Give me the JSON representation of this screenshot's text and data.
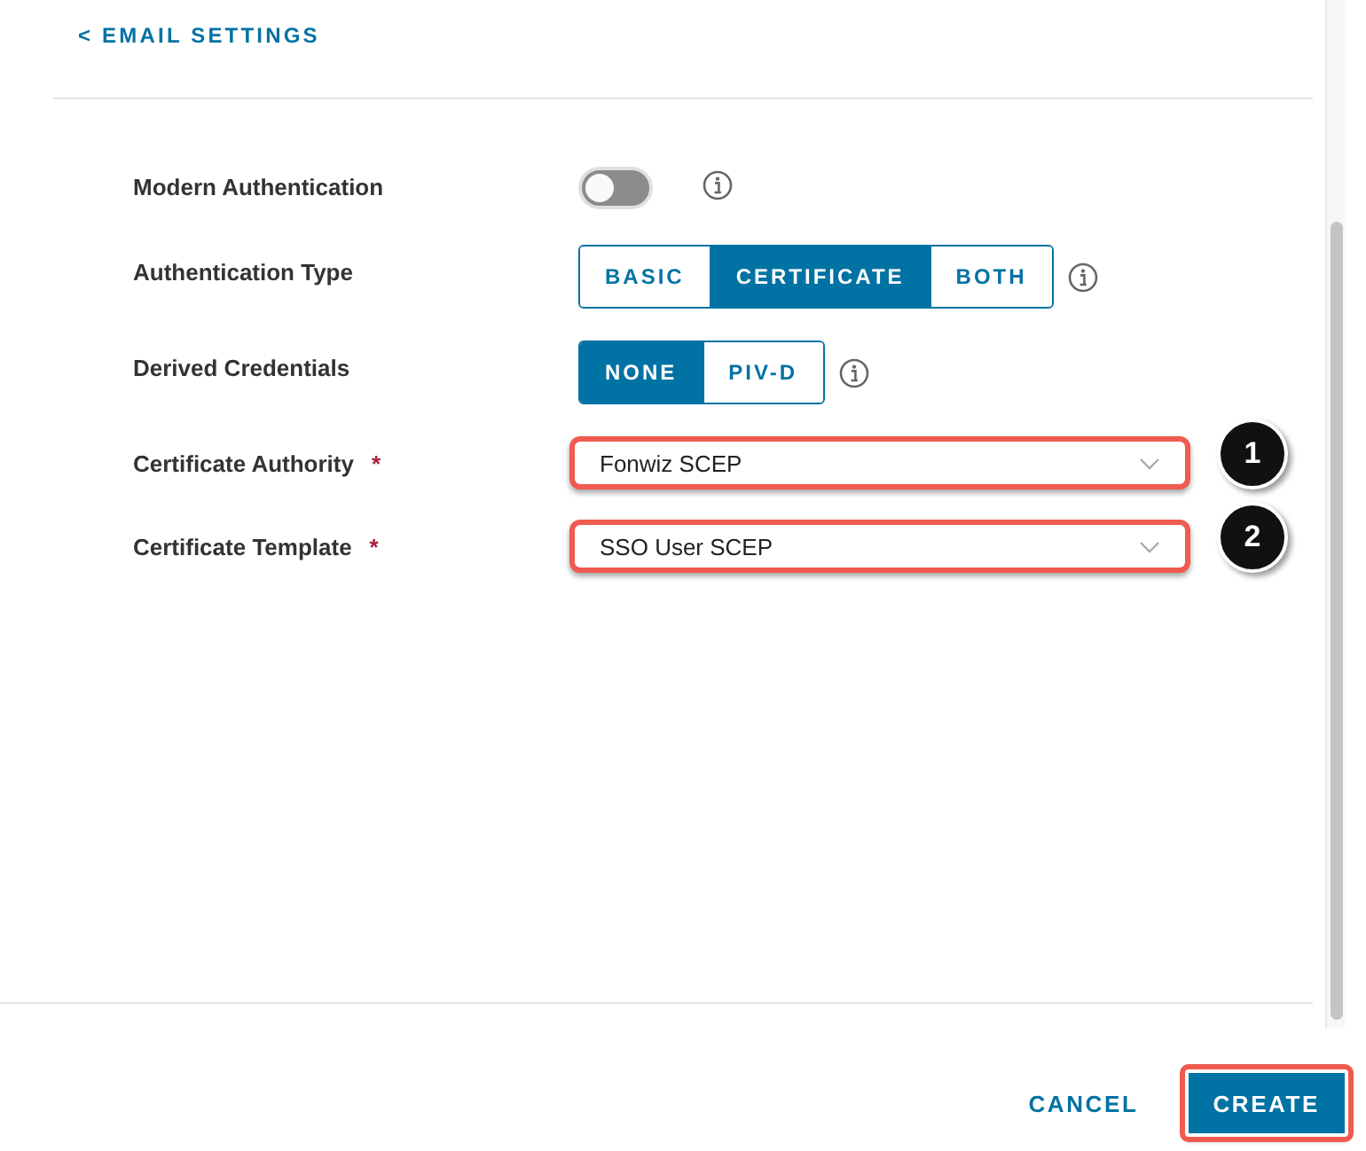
{
  "back_link": "< EMAIL SETTINGS",
  "fields": [
    {
      "kind": "toggle",
      "label": "Modern Authentication",
      "on": false,
      "info": true
    },
    {
      "kind": "segmented",
      "label": "Authentication Type",
      "info": true,
      "options": [
        {
          "label": "BASIC",
          "selected": false
        },
        {
          "label": "CERTIFICATE",
          "selected": true
        },
        {
          "label": "BOTH",
          "selected": false
        }
      ]
    },
    {
      "kind": "segmented",
      "label": "Derived Credentials",
      "info": true,
      "options": [
        {
          "label": "NONE",
          "selected": true
        },
        {
          "label": "PIV-D",
          "selected": false
        }
      ]
    },
    {
      "kind": "select",
      "label": "Certificate Authority",
      "required_mark": "*",
      "value": "Fonwiz SCEP",
      "highlighted": true,
      "callout": "1"
    },
    {
      "kind": "select",
      "label": "Certificate Template",
      "required_mark": "*",
      "value": "SSO User SCEP",
      "highlighted": true,
      "callout": "2"
    }
  ],
  "buttons": [
    {
      "label": "CANCEL",
      "primary": false,
      "highlighted": false
    },
    {
      "label": "CREATE",
      "primary": true,
      "highlighted": true
    }
  ]
}
